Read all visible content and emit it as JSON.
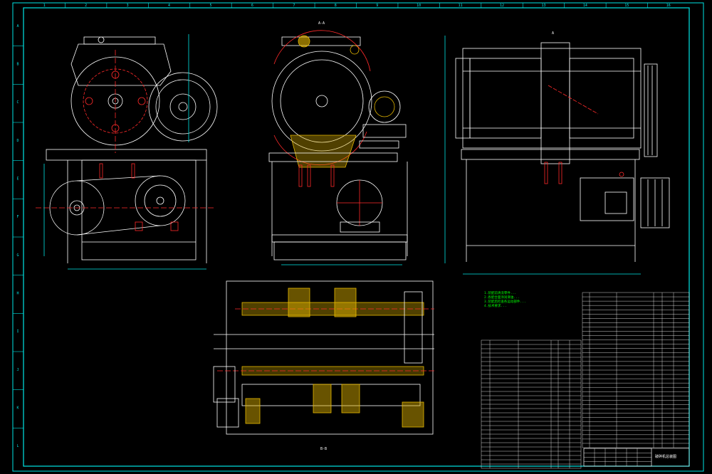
{
  "border": {
    "top_zones": [
      "1",
      "2",
      "3",
      "4",
      "5",
      "6",
      "7",
      "8",
      "9",
      "10",
      "11",
      "12",
      "13",
      "14",
      "15",
      "16"
    ],
    "left_zones": [
      "A",
      "B",
      "C",
      "D",
      "E",
      "F",
      "G",
      "H",
      "I",
      "J",
      "K",
      "L"
    ]
  },
  "views": {
    "section_aa": "A-A",
    "section_bb": "B-B",
    "section_a": "A"
  },
  "colors": {
    "frame": "#00e5e5",
    "outline": "#ffffff",
    "centerline": "#ff2a2a",
    "hatch": "#e6b800",
    "notes": "#00ff00"
  },
  "notes": [
    "1.装配前清洗零件...",
    "2.各配合面涂润滑油...",
    "3.装配后检查各运动部件...",
    "4.技术要求..."
  ],
  "title_block": {
    "name": "破碎机总装图"
  }
}
